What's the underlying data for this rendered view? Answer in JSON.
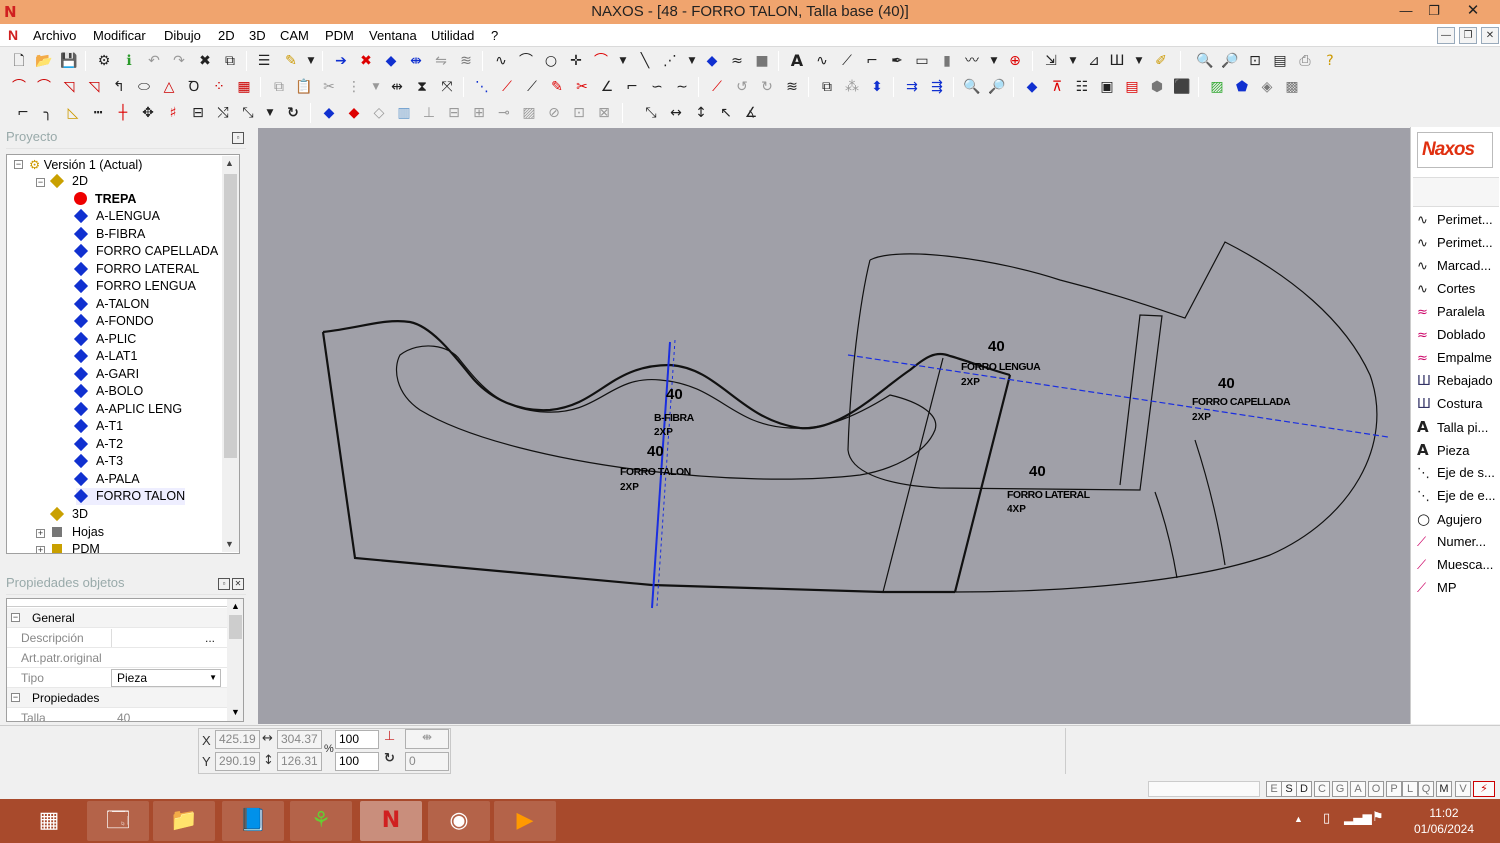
{
  "window": {
    "title": "NAXOS - [48 - FORRO TALON, Talla base (40)]",
    "app_icon": "N",
    "minimize": "—",
    "restore": "❐",
    "close": "✕"
  },
  "menu": {
    "items": [
      "Archivo",
      "Modificar",
      "Dibujo",
      "2D",
      "3D",
      "CAM",
      "PDM",
      "Ventana",
      "Utilidad",
      "?"
    ]
  },
  "project_panel": {
    "title": "Proyecto"
  },
  "tree": {
    "root": "Versión 1 (Actual)",
    "node_2d": "2D",
    "active_item": "TREPA",
    "items": [
      "A-LENGUA",
      "B-FIBRA",
      "FORRO CAPELLADA",
      "FORRO LATERAL",
      "FORRO LENGUA",
      "A-TALON",
      "A-FONDO",
      "A-PLIC",
      "A-LAT1",
      "A-GARI",
      "A-BOLO",
      "A-APLIC LENG",
      "A-T1",
      "A-T2",
      "A-T3",
      "A-PALA",
      "FORRO TALON"
    ],
    "node_3d": "3D",
    "hojas": "Hojas",
    "pdm": "PDM"
  },
  "props_panel": {
    "title": "Propiedades objetos",
    "group_general": "General",
    "descripcion_label": "Descripción",
    "art_label": "Art.patr.original",
    "tipo_label": "Tipo",
    "tipo_value": "Pieza",
    "group_propiedades": "Propiedades",
    "talla_label": "Talla",
    "talla_value": "40",
    "ellipsis": "..."
  },
  "canvas": {
    "pieces": [
      {
        "size": "40",
        "name": "B-FIBRA",
        "qty": "2XP"
      },
      {
        "size": "40",
        "name": "FORRO TALON",
        "qty": "2XP"
      },
      {
        "size": "40",
        "name": "FORRO LENGUA",
        "qty": "2XP"
      },
      {
        "size": "40",
        "name": "FORRO CAPELLADA",
        "qty": "2XP"
      },
      {
        "size": "40",
        "name": "FORRO LATERAL",
        "qty": "4XP"
      }
    ]
  },
  "right_tools": [
    {
      "icon": "curve-icon",
      "label": "Perimet..."
    },
    {
      "icon": "curve-icon",
      "label": "Perimet..."
    },
    {
      "icon": "curve-icon",
      "label": "Marcad..."
    },
    {
      "icon": "curve-icon",
      "label": "Cortes"
    },
    {
      "icon": "parallel-icon",
      "label": "Paralela"
    },
    {
      "icon": "parallel-icon",
      "label": "Doblado"
    },
    {
      "icon": "parallel-icon",
      "label": "Empalme"
    },
    {
      "icon": "stitch-icon",
      "label": "Rebajado"
    },
    {
      "icon": "stitch-icon",
      "label": "Costura"
    },
    {
      "icon": "text-icon",
      "label": "Talla pi..."
    },
    {
      "icon": "text-icon",
      "label": "Pieza"
    },
    {
      "icon": "axis-icon",
      "label": "Eje de s..."
    },
    {
      "icon": "axis-icon",
      "label": "Eje de e..."
    },
    {
      "icon": "circle-icon",
      "label": "Agujero"
    },
    {
      "icon": "line-icon",
      "label": "Numer..."
    },
    {
      "icon": "line-icon",
      "label": "Muesca..."
    },
    {
      "icon": "line-icon",
      "label": "MP"
    }
  ],
  "logo_text": "Naxos",
  "coords": {
    "x_label": "X",
    "y_label": "Y",
    "x": "425.19",
    "y": "290.19",
    "w": "304.37",
    "h": "126.31",
    "sx": "100",
    "sy": "100",
    "angle": "0",
    "pct": "%"
  },
  "status_letters": [
    "E",
    "S",
    "D",
    "C",
    "G",
    "A",
    "O",
    "P",
    "L",
    "Q",
    "M",
    "V"
  ],
  "clock": {
    "time": "11:02",
    "date": "01/06/2024"
  },
  "colors": {
    "titlebar": "#f0a46e",
    "canvas": "#a0a0a8",
    "taskbar": "#a84a2c",
    "tree_diamond": "#1030d0",
    "active_dot": "#e00000",
    "axis_blue": "#1a2ee0"
  }
}
